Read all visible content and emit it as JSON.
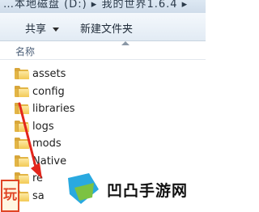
{
  "titlebar": {
    "path": "…本地磁盘 (D:) ▸ 我的世界1.6.4 ▸"
  },
  "toolbar": {
    "share_label": "共享",
    "new_folder_label": "新建文件夹"
  },
  "list": {
    "name_column": "名称",
    "files": [
      {
        "name": "assets",
        "icon": "folder-icon"
      },
      {
        "name": "config",
        "icon": "folder-icon"
      },
      {
        "name": "libraries",
        "icon": "folder-icon"
      },
      {
        "name": "logs",
        "icon": "folder-icon"
      },
      {
        "name": "mods",
        "icon": "folder-icon"
      },
      {
        "name": "Native",
        "icon": "folder-icon"
      },
      {
        "name": "re",
        "icon": "folder-icon"
      },
      {
        "name": "sa",
        "icon": "folder-icon"
      }
    ]
  },
  "annotation": {
    "arrow_color": "#e3261c"
  },
  "overlay": {
    "left_logo_text": "玩",
    "watermark_text": "凹凸手游网",
    "watermark_logo_colors": [
      "#29a9e0",
      "#7cc242"
    ]
  }
}
